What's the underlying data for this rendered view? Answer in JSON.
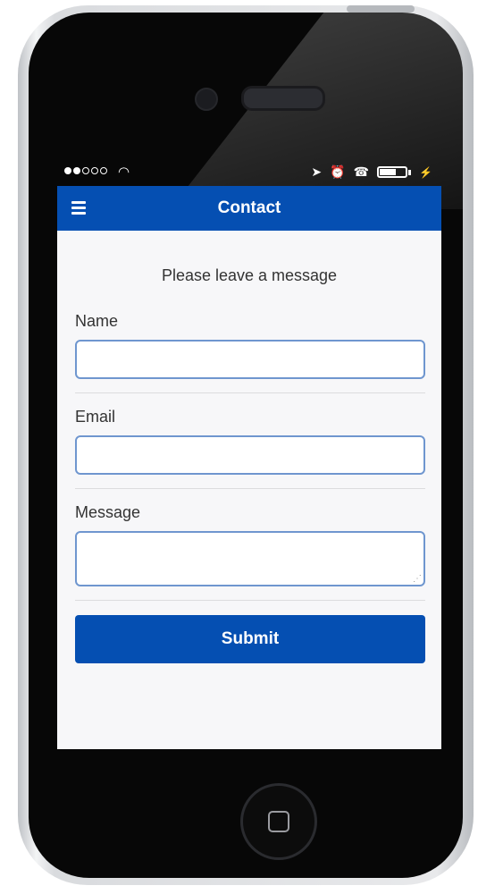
{
  "status_bar": {
    "signal_dots_filled": 2,
    "signal_dots_total": 5,
    "icons": [
      "wifi-icon",
      "location-arrow-icon",
      "alarm-icon",
      "tty-icon",
      "battery-icon",
      "charging-bolt-icon"
    ]
  },
  "app_header": {
    "title": "Contact",
    "menu_icon": "hamburger-menu-icon",
    "color": "#054fb2"
  },
  "form": {
    "intro": "Please leave a message",
    "fields": [
      {
        "label": "Name",
        "value": ""
      },
      {
        "label": "Email",
        "value": ""
      },
      {
        "label": "Message",
        "value": ""
      }
    ],
    "submit_label": "Submit"
  }
}
